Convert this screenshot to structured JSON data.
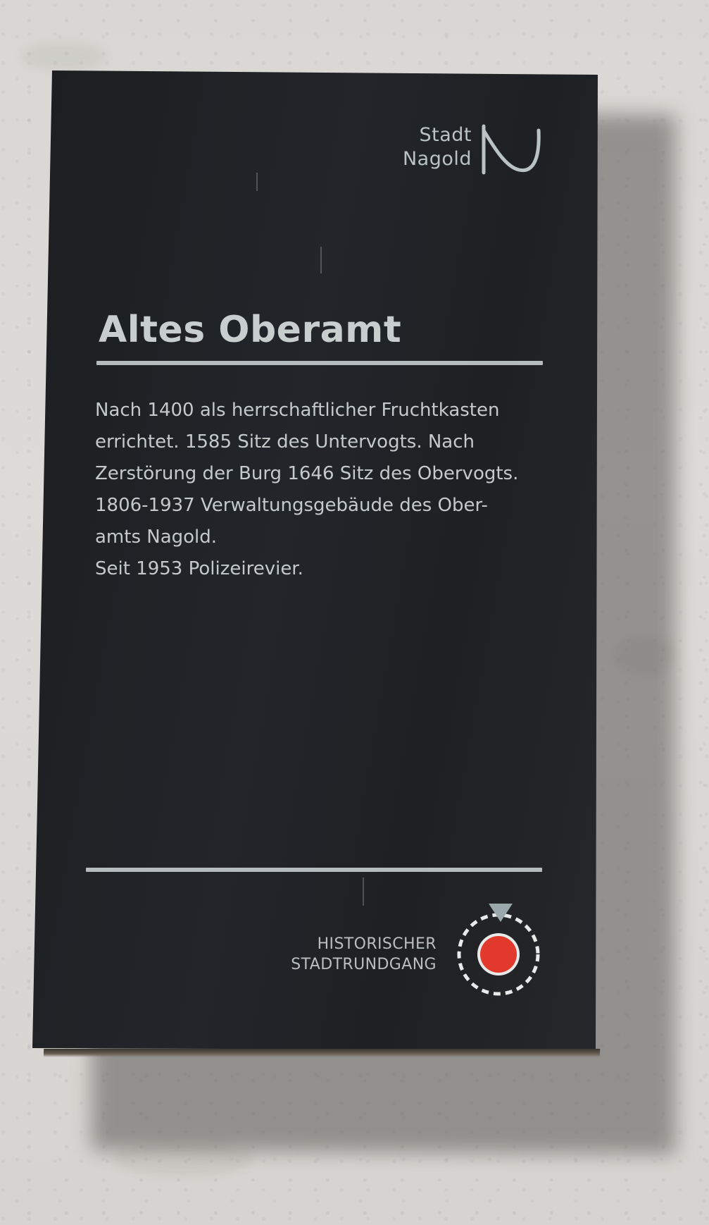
{
  "logo": {
    "line1": "Stadt",
    "line2": "Nagold"
  },
  "sign": {
    "title": "Altes Oberamt",
    "body_lines": [
      "Nach 1400 als herrschaftlicher Fruchtkasten",
      "errichtet. 1585 Sitz des Untervogts. Nach",
      "Zerstörung der Burg 1646 Sitz des Obervogts.",
      "1806-1937 Verwaltungsgebäude des Ober-",
      "amts Nagold.",
      "Seit 1953 Polizeirevier."
    ]
  },
  "tour": {
    "line1": "HISTORISCHER",
    "line2": "STADTRUNDGANG",
    "marker_color": "#e1392b"
  },
  "colors": {
    "plaque": "#1f2225",
    "text": "#c4c9ca",
    "wall": "#d9d7d3"
  }
}
